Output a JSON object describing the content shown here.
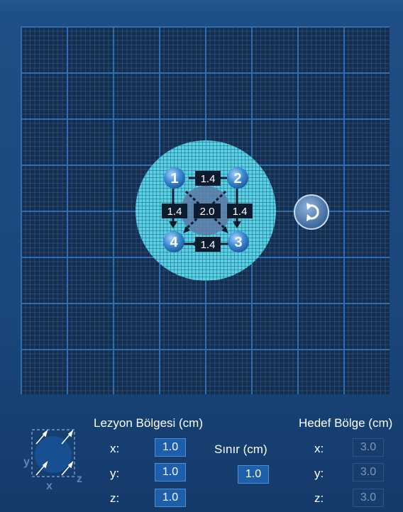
{
  "grid": {
    "points": [
      {
        "id": "1",
        "color": "#3b8ad4"
      },
      {
        "id": "2",
        "color": "#3b8ad4"
      },
      {
        "id": "3",
        "color": "#3b8ad4"
      },
      {
        "id": "4",
        "color": "#3b8ad4"
      }
    ],
    "distances": {
      "top": "1.4",
      "left": "1.4",
      "center": "2.0",
      "right": "1.4",
      "bottom": "1.4"
    },
    "target_zone_color": "#56cbe0",
    "lesion_color": "#5c7aa6"
  },
  "rotate_button": {
    "icon": "rotate-icon"
  },
  "lesion": {
    "title": "Lezyon Bölgesi (cm)",
    "x_label": "x:",
    "x_value": "1.0",
    "y_label": "y:",
    "y_value": "1.0",
    "z_label": "z:",
    "z_value": "1.0"
  },
  "margin": {
    "title": "Sınır (cm)",
    "value": "1.0"
  },
  "target": {
    "title": "Hedef Bölge (cm)",
    "x_label": "x:",
    "x_value": "3.0",
    "y_label": "y:",
    "y_value": "3.0",
    "z_label": "z:",
    "z_value": "3.0"
  },
  "axis_widget": {
    "x": "x",
    "y": "y",
    "z": "z"
  }
}
